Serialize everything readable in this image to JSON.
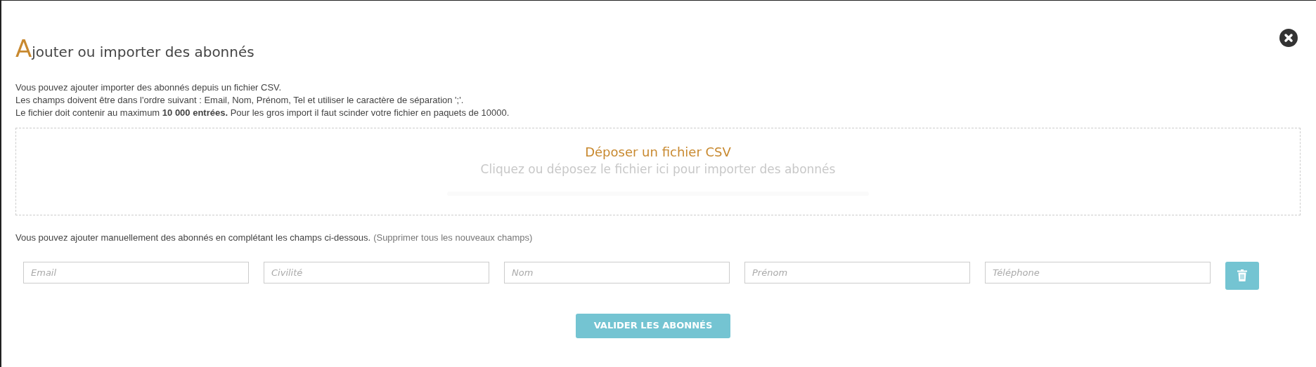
{
  "dialog": {
    "title": "Ajouter ou importer des abonnés"
  },
  "intro": [
    "Vous pouvez ajouter importer des abonnés depuis un fichier CSV.",
    "Les champs doivent être dans l'ordre suivant : Email, Nom, Prénom, Tel et utiliser le caractère de séparation ';'.",
    "Le fichier doit contenir au maximum **10 000 entrées.** Pour les gros import il faut scinder votre fichier en paquets de 10000."
  ],
  "dropzone": {
    "title": "Déposer un fichier CSV",
    "hint": "Cliquez ou déposez le fichier ici pour importer des abonnés"
  },
  "manual": {
    "text": "Vous pouvez ajouter manuellement des abonnés en complétant les champs ci-dessous.",
    "link": "(Supprimer tous les nouveaux champs)"
  },
  "fields": [
    {
      "placeholder": "Email"
    },
    {
      "placeholder": "Civilité"
    },
    {
      "placeholder": "Nom"
    },
    {
      "placeholder": "Prénom"
    },
    {
      "placeholder": "Téléphone"
    }
  ],
  "submit": "VALIDER LES ABONNÉS"
}
